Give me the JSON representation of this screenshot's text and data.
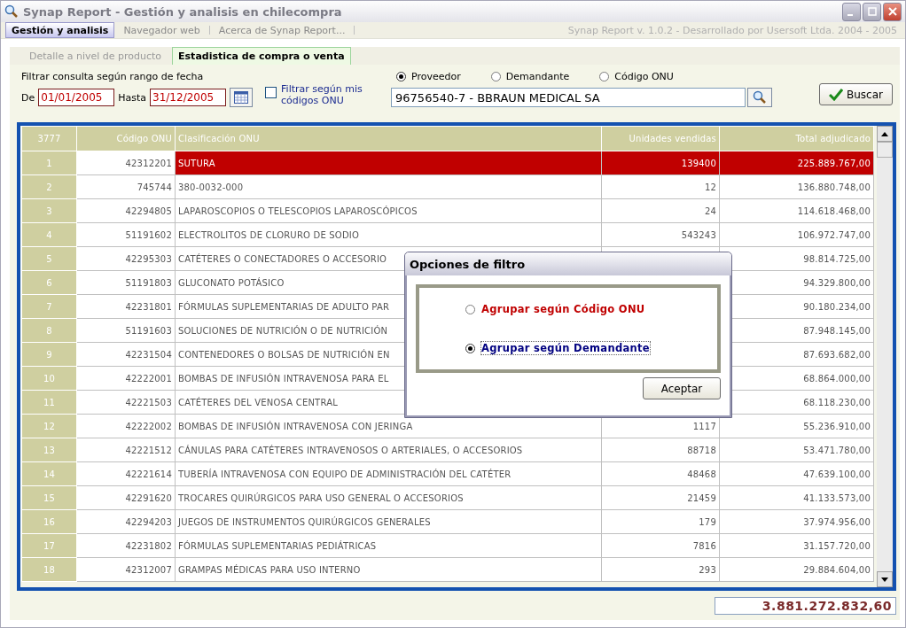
{
  "window": {
    "title": "Synap Report - Gestión y analisis en chilecompra"
  },
  "main_tabs": [
    {
      "label": "Gestión y analisis",
      "selected": true
    },
    {
      "label": "Navegador web",
      "selected": false
    },
    {
      "label": "Acerca de Synap Report...",
      "selected": false
    }
  ],
  "version": "Synap Report v. 1.0.2 - Desarrollado por Usersoft Ltda. 2004 - 2005",
  "sub_tabs": [
    {
      "label": "Detalle a nivel de producto",
      "selected": false
    },
    {
      "label": "Estadistica de compra o venta",
      "selected": true
    }
  ],
  "filter": {
    "date_label": "Filtrar consulta según rango de fecha",
    "from_label": "De",
    "from": "01/01/2005",
    "to_label": "Hasta",
    "to": "31/12/2005",
    "my_codes": {
      "label": "Filtrar según mis códigos ONU",
      "checked": false
    },
    "types": [
      {
        "label": "Proveedor",
        "selected": true
      },
      {
        "label": "Demandante",
        "selected": false
      },
      {
        "label": "Código ONU",
        "selected": false
      }
    ],
    "entity": "96756540-7 - BBRAUN MEDICAL SA",
    "search_button": "Buscar"
  },
  "table": {
    "columns": [
      "3777",
      "Código ONU",
      "Clasificación ONU",
      "Unidades vendidas",
      "Total adjudicado"
    ],
    "rows": [
      {
        "num": "1",
        "code": "42312201",
        "name": "SUTURA",
        "units": "139400",
        "total": "225.889.767,00",
        "selected": true
      },
      {
        "num": "2",
        "code": "745744",
        "name": "380-0032-000",
        "units": "12",
        "total": "136.880.748,00",
        "selected": false
      },
      {
        "num": "3",
        "code": "42294805",
        "name": "LAPAROSCOPIOS O TELESCOPIOS LAPAROSCÓPICOS",
        "units": "24",
        "total": "114.618.468,00",
        "selected": false
      },
      {
        "num": "4",
        "code": "51191602",
        "name": "ELECTROLITOS DE CLORURO DE SODIO",
        "units": "543243",
        "total": "106.972.747,00",
        "selected": false
      },
      {
        "num": "5",
        "code": "42295303",
        "name": "CATÉTERES O CONECTADORES O ACCESORIO",
        "total": "98.814.725,00",
        "selected": false
      },
      {
        "num": "6",
        "code": "51191803",
        "name": "GLUCONATO POTÁSICO",
        "total": "94.329.800,00",
        "selected": false
      },
      {
        "num": "7",
        "code": "42231801",
        "name": "FÓRMULAS SUPLEMENTARIAS DE ADULTO PAR",
        "total": "90.180.234,00",
        "selected": false
      },
      {
        "num": "8",
        "code": "51191603",
        "name": "SOLUCIONES DE NUTRICIÓN O DE NUTRICIÓN",
        "total": "87.948.145,00",
        "selected": false
      },
      {
        "num": "9",
        "code": "42231504",
        "name": "CONTENEDORES O BOLSAS DE NUTRICIÓN EN",
        "total": "87.693.682,00",
        "selected": false
      },
      {
        "num": "10",
        "code": "42222001",
        "name": "BOMBAS DE INFUSIÓN INTRAVENOSA PARA EL",
        "total": "68.864.000,00",
        "selected": false
      },
      {
        "num": "11",
        "code": "42221503",
        "name": "CATÉTERES DEL VENOSA CENTRAL",
        "total": "68.118.230,00",
        "selected": false
      },
      {
        "num": "12",
        "code": "42222002",
        "name": "BOMBAS DE INFUSIÓN INTRAVENOSA CON JERINGA",
        "units": "1117",
        "total": "55.236.910,00",
        "selected": false
      },
      {
        "num": "13",
        "code": "42221512",
        "name": "CÁNULAS PARA CATÉTERES INTRAVENOSOS O ARTERIALES, O ACCESORIOS",
        "units": "88718",
        "total": "53.471.780,00",
        "selected": false
      },
      {
        "num": "14",
        "code": "42221614",
        "name": "TUBERÍA INTRAVENOSA CON EQUIPO DE ADMINISTRACIÓN DEL CATÉTER",
        "units": "48468",
        "total": "47.639.100,00",
        "selected": false
      },
      {
        "num": "15",
        "code": "42291620",
        "name": "TROCARES QUIRÚRGICOS PARA USO GENERAL O ACCESORIOS",
        "units": "21459",
        "total": "41.133.573,00",
        "selected": false
      },
      {
        "num": "16",
        "code": "42294203",
        "name": "JUEGOS DE INSTRUMENTOS QUIRÚRGICOS GENERALES",
        "units": "179",
        "total": "37.974.956,00",
        "selected": false
      },
      {
        "num": "17",
        "code": "42231802",
        "name": "FÓRMULAS SUPLEMENTARIAS PEDIÁTRICAS",
        "units": "7816",
        "total": "31.157.720,00",
        "selected": false
      },
      {
        "num": "18",
        "code": "42312007",
        "name": "GRAMPAS MÉDICAS PARA USO INTERNO",
        "units": "293",
        "total": "29.884.604,00",
        "selected": false
      }
    ]
  },
  "grand_total": "3.881.272.832,60",
  "dialog": {
    "title": "Opciones de filtro",
    "options": [
      {
        "label": "Agrupar según Código ONU",
        "selected": false,
        "color": "#c00000"
      },
      {
        "label": "Agrupar según Demandante",
        "selected": true,
        "color": "#000080"
      }
    ],
    "button": "Aceptar"
  }
}
